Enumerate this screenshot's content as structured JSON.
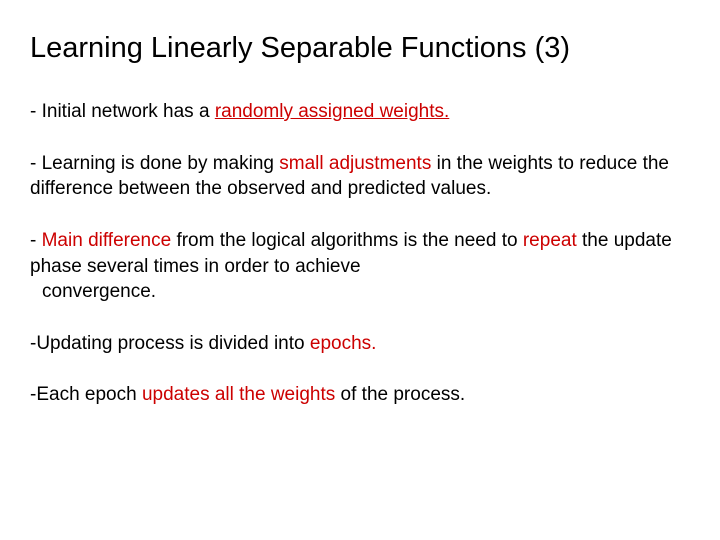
{
  "title": "Learning Linearly Separable Functions (3)",
  "p1": {
    "lead": "- Initial network has a ",
    "hl": "randomly assigned weights."
  },
  "p2": {
    "lead": "- Learning is done by making ",
    "hl": "small adjustments",
    "rest": " in the weights to reduce  the difference between the observed and predicted values."
  },
  "p3": {
    "lead": "- ",
    "hl1": "Main difference",
    "mid": " from the logical algorithms is the need to ",
    "hl2": "repeat",
    "rest1": "  the update phase several times in order to achieve",
    "rest2": "convergence."
  },
  "p4": {
    "lead": "-Updating process is divided into ",
    "hl": "epochs."
  },
  "p5": {
    "lead": "-Each epoch  ",
    "hl": "updates all the weights",
    "rest": " of the process."
  }
}
